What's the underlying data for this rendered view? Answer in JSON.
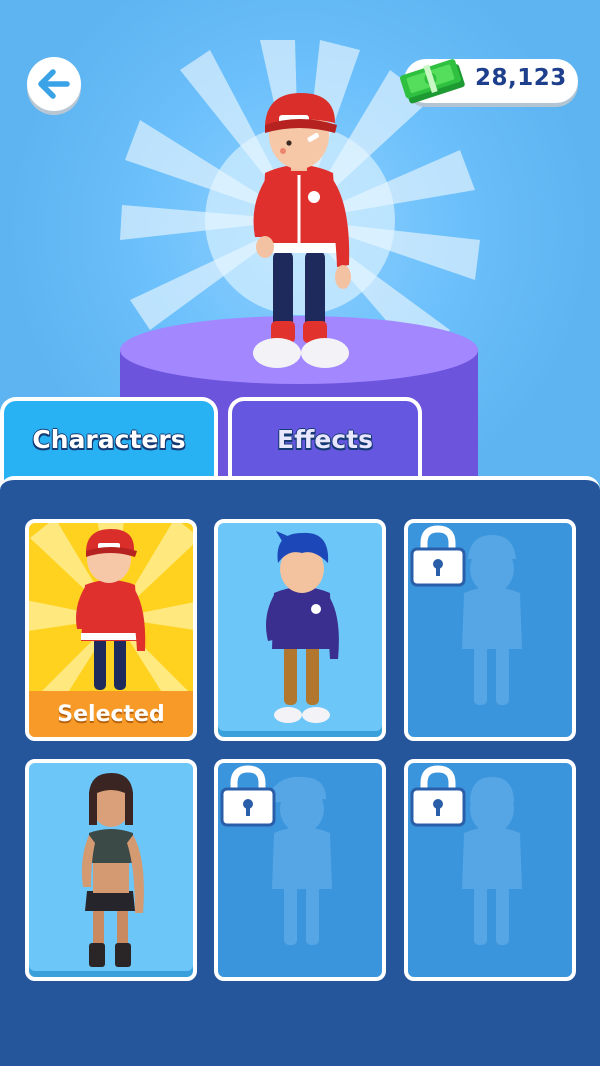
{
  "header": {
    "back_icon": "arrow-left-icon",
    "currency_icon": "cash-stack-icon",
    "currency_amount": "28,123"
  },
  "tabs": [
    {
      "label": "Characters",
      "active": true
    },
    {
      "label": "Effects",
      "active": false
    }
  ],
  "characters": [
    {
      "id": "red-cap",
      "state": "selected",
      "badge": "Selected"
    },
    {
      "id": "blue-hair",
      "state": "unlocked"
    },
    {
      "id": "locked-1",
      "state": "locked",
      "icon": "lock-icon"
    },
    {
      "id": "girl",
      "state": "unlocked"
    },
    {
      "id": "locked-2",
      "state": "locked",
      "icon": "lock-icon"
    },
    {
      "id": "locked-3",
      "state": "locked",
      "icon": "lock-icon"
    }
  ],
  "colors": {
    "background": "#5cb3ee",
    "panel": "#25569b",
    "tab_characters": "#28b2f3",
    "tab_effects": "#6657e0",
    "selected_card": "#ffd21f",
    "selected_badge": "#f79a27",
    "pedestal": "#8e7cf5"
  }
}
